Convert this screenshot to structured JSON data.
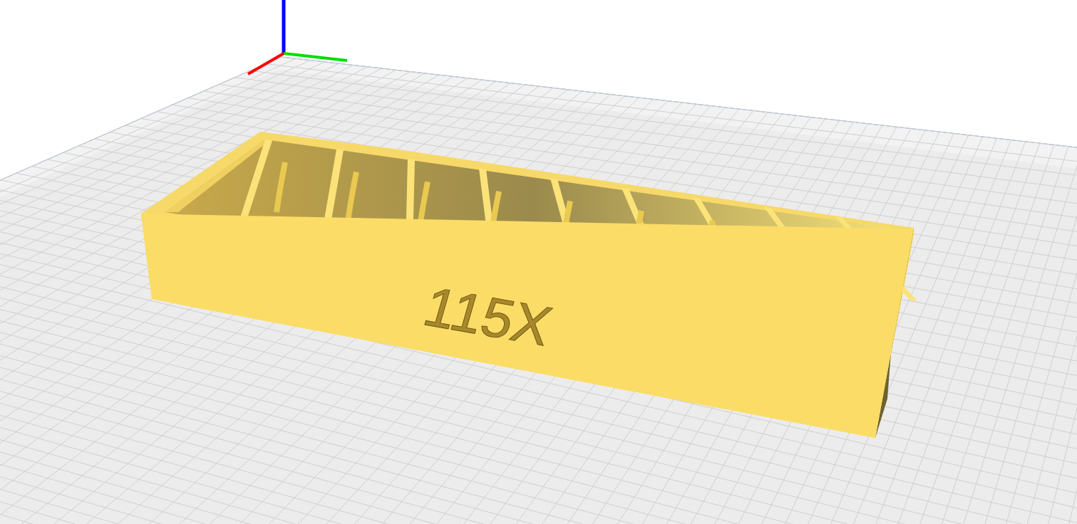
{
  "model": {
    "label": "115X"
  }
}
